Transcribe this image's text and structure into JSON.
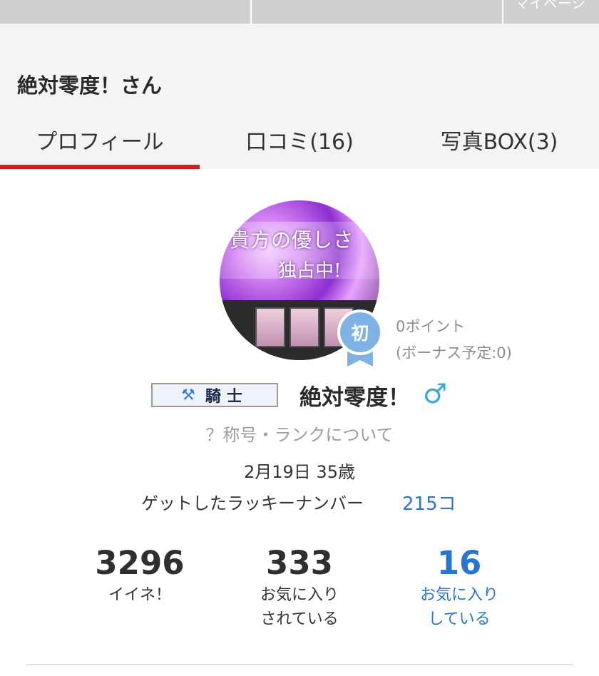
{
  "topnav": {
    "mypage_label": "マイページ"
  },
  "header": {
    "title": "絶対零度！さん"
  },
  "tabs": [
    {
      "label": "プロフィール",
      "active": true
    },
    {
      "label": "口コミ(16)",
      "active": false
    },
    {
      "label": "写真BOX(3)",
      "active": false
    }
  ],
  "profile": {
    "avatar_caption_line1": "貴方の優しさ",
    "avatar_caption_line2": "独占中!",
    "beginner_badge": "初",
    "points": "0ポイント",
    "bonus_pending": "(ボーナス予定:0)",
    "rank_title": "騎士",
    "rank_icon": "crossed-axes-icon",
    "username": "絶対零度！",
    "gender_symbol": "♂",
    "rank_help_link": "？称号・ランクについて",
    "birthday_age": "2月19日 35歳",
    "lucky_label": "ゲットしたラッキーナンバー",
    "lucky_value": "215コ"
  },
  "stats": [
    {
      "number": "3296",
      "label_line1": "イイネ！",
      "label_line2": ""
    },
    {
      "number": "333",
      "label_line1": "お気に入り",
      "label_line2": "されている"
    },
    {
      "number": "16",
      "label_line1": "お気に入り",
      "label_line2": "している"
    }
  ],
  "colors": {
    "accent_red": "#d21e1e",
    "link_blue": "#2a75d2",
    "badge_blue": "#7fb3e6",
    "male_blue": "#3fa9d6"
  }
}
